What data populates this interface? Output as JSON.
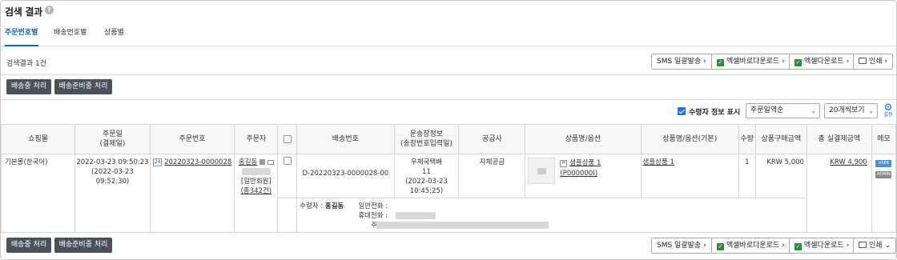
{
  "page_title": "검색 결과",
  "help_glyph": "?",
  "tabs": [
    "주문번호별",
    "배송번호별",
    "상품별"
  ],
  "result_count": "검색결과 1건",
  "toolbar": {
    "sms": "SMS 일괄발송",
    "excel_direct": "엑셀바로다운로드",
    "excel_download": "엑셀다운로드",
    "print": "인쇄",
    "caret": "›",
    "down_caret": "⌄"
  },
  "actions": {
    "shipping": "배송중 처리",
    "preparing": "배송준비중 처리"
  },
  "options": {
    "show_recipient_label": "수령자 정보 표시",
    "show_recipient_checked": true,
    "sort_value": "주문일역순",
    "page_size_value": "20개씩보기",
    "settings_label": "설정"
  },
  "table": {
    "headers": {
      "mall": "쇼핑몰",
      "order_date": "주문일",
      "order_date_sub": "(결제일)",
      "order_no": "주문번호",
      "orderer": "주문자",
      "shipping_no": "배송번호",
      "invoice": "운송장정보",
      "invoice_sub": "(송장번호입력일)",
      "supplier": "공급사",
      "product": "상품명/옵션",
      "product_base": "상품명/옵션(기본)",
      "qty": "수량",
      "price": "상품구매금액",
      "total": "총 실결제금액",
      "memo": "메모"
    },
    "row": {
      "mall": "기본몰(한국어)",
      "order_date": "2022-03-23 09:50:23",
      "paid_date": "(2022-03-23 09:52:30)",
      "order_badge": "24",
      "order_no": "20220323-0000028",
      "orderer_name": "홍길동",
      "member_type": "[일반회원]",
      "order_count": "(총342건)",
      "shipping_no": "D-20220323-0000028-00",
      "carrier": "우체국택배",
      "invoice_no": "11",
      "invoice_date": "(2022-03-23",
      "invoice_time": "10:45:25)",
      "supplier": "자체공급",
      "option_badge": "H",
      "product_name": "샘플상품 1",
      "product_code": "(P000000I)",
      "product_base": "샘플상품 1",
      "qty": "1",
      "price": "KRW 5,000",
      "total": "KRW 4,900",
      "memo_tags": [
        "USER",
        "ADMIN"
      ],
      "recipient_label": "수령자 :",
      "recipient_name": "홍길동",
      "phone_label": "일반전화 :",
      "mobile_label": "휴대전화 :",
      "address_label": "주소 :"
    }
  },
  "colors": {
    "accent": "#1a5fb4",
    "dark_button": "#4a5159",
    "excel_green": "#2e8b3d",
    "user_tag": "#4a90d9",
    "admin_tag": "#8a8a8a"
  }
}
